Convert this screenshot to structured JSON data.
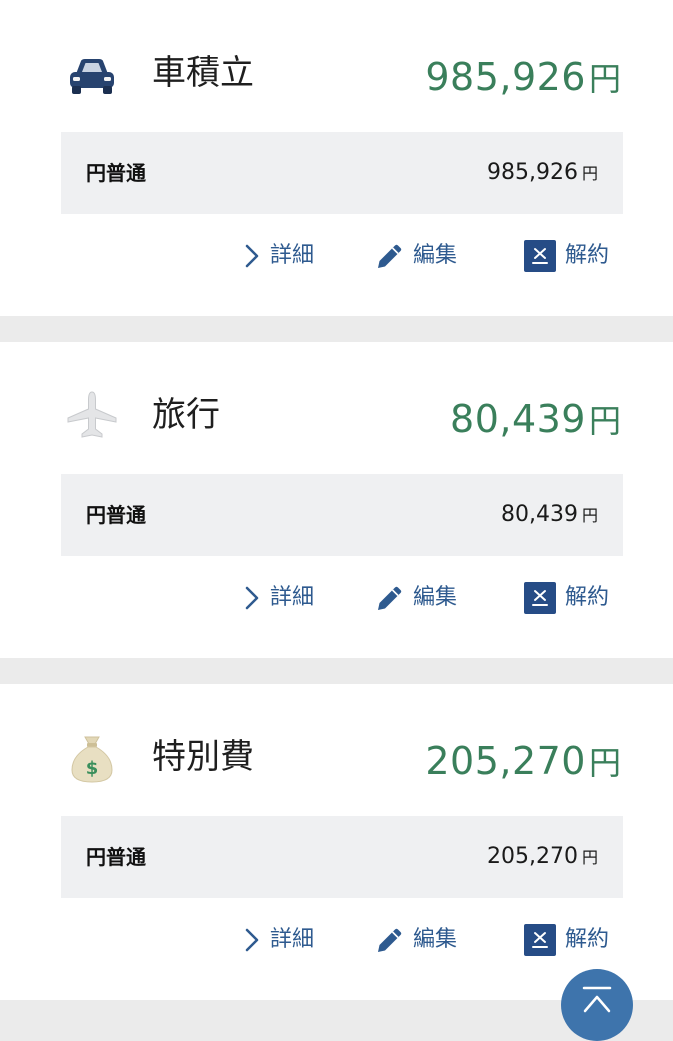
{
  "cards": [
    {
      "icon": "car-icon",
      "title": "車積立",
      "amount": "985,926",
      "currency": "円",
      "account_type": "円普通",
      "account_amount": "985,926",
      "account_currency": "円"
    },
    {
      "icon": "airplane-icon",
      "title": "旅行",
      "amount": "80,439",
      "currency": "円",
      "account_type": "円普通",
      "account_amount": "80,439",
      "account_currency": "円"
    },
    {
      "icon": "money-bag-icon",
      "title": "特別費",
      "amount": "205,270",
      "currency": "円",
      "account_type": "円普通",
      "account_amount": "205,270",
      "account_currency": "円"
    }
  ],
  "actions": {
    "detail_label": "詳細",
    "edit_label": "編集",
    "cancel_label": "解約"
  },
  "colors": {
    "amount_green": "#3a7f5b",
    "action_blue": "#2e5a8f",
    "cancel_box_navy": "#264c86",
    "subrow_gray": "#eff0f2",
    "page_gray": "#ebebeb",
    "top_button_blue": "#3e74ac"
  },
  "scroll_top_icon": "back-to-top-icon"
}
